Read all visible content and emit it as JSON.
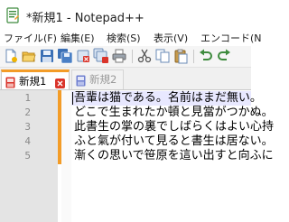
{
  "window": {
    "title": "*新規1 - Notepad++"
  },
  "menu": {
    "items": [
      "ファイル(F)",
      "編集(E)",
      "検索(S)",
      "表示(V)",
      "エンコード(N"
    ]
  },
  "toolbar": {
    "buttons": [
      "new-file-icon",
      "open-file-icon",
      "save-icon",
      "save-all-icon",
      "close-icon",
      "close-all-icon",
      "print-icon",
      "cut-icon",
      "copy-icon",
      "paste-icon",
      "undo-icon",
      "redo-icon"
    ]
  },
  "tabs": [
    {
      "label": "新規1",
      "active": true,
      "modified": true,
      "color": "#d9342b"
    },
    {
      "label": "新規2",
      "active": false,
      "modified": false,
      "color": "#6f7fd0"
    }
  ],
  "editor": {
    "lines": [
      {
        "num": "1",
        "text": "吾輩は猫である。名前はまだ無い。"
      },
      {
        "num": "2",
        "text": "どこで生まれたか頓と見當がつかぬ。"
      },
      {
        "num": "3",
        "text": "此書生の掌の裏でしばらくはよい心持"
      },
      {
        "num": "4",
        "text": "ふと氣が付いて見ると書生は居ない。"
      },
      {
        "num": "5",
        "text": "漸くの思いで笹原を這い出すと向ふに"
      }
    ],
    "colors": {
      "gutter": "#e4e4e4",
      "change_bar": "#f39c27",
      "caret_line": "#e8e8ff",
      "line_number": "#8a8a8a"
    }
  }
}
